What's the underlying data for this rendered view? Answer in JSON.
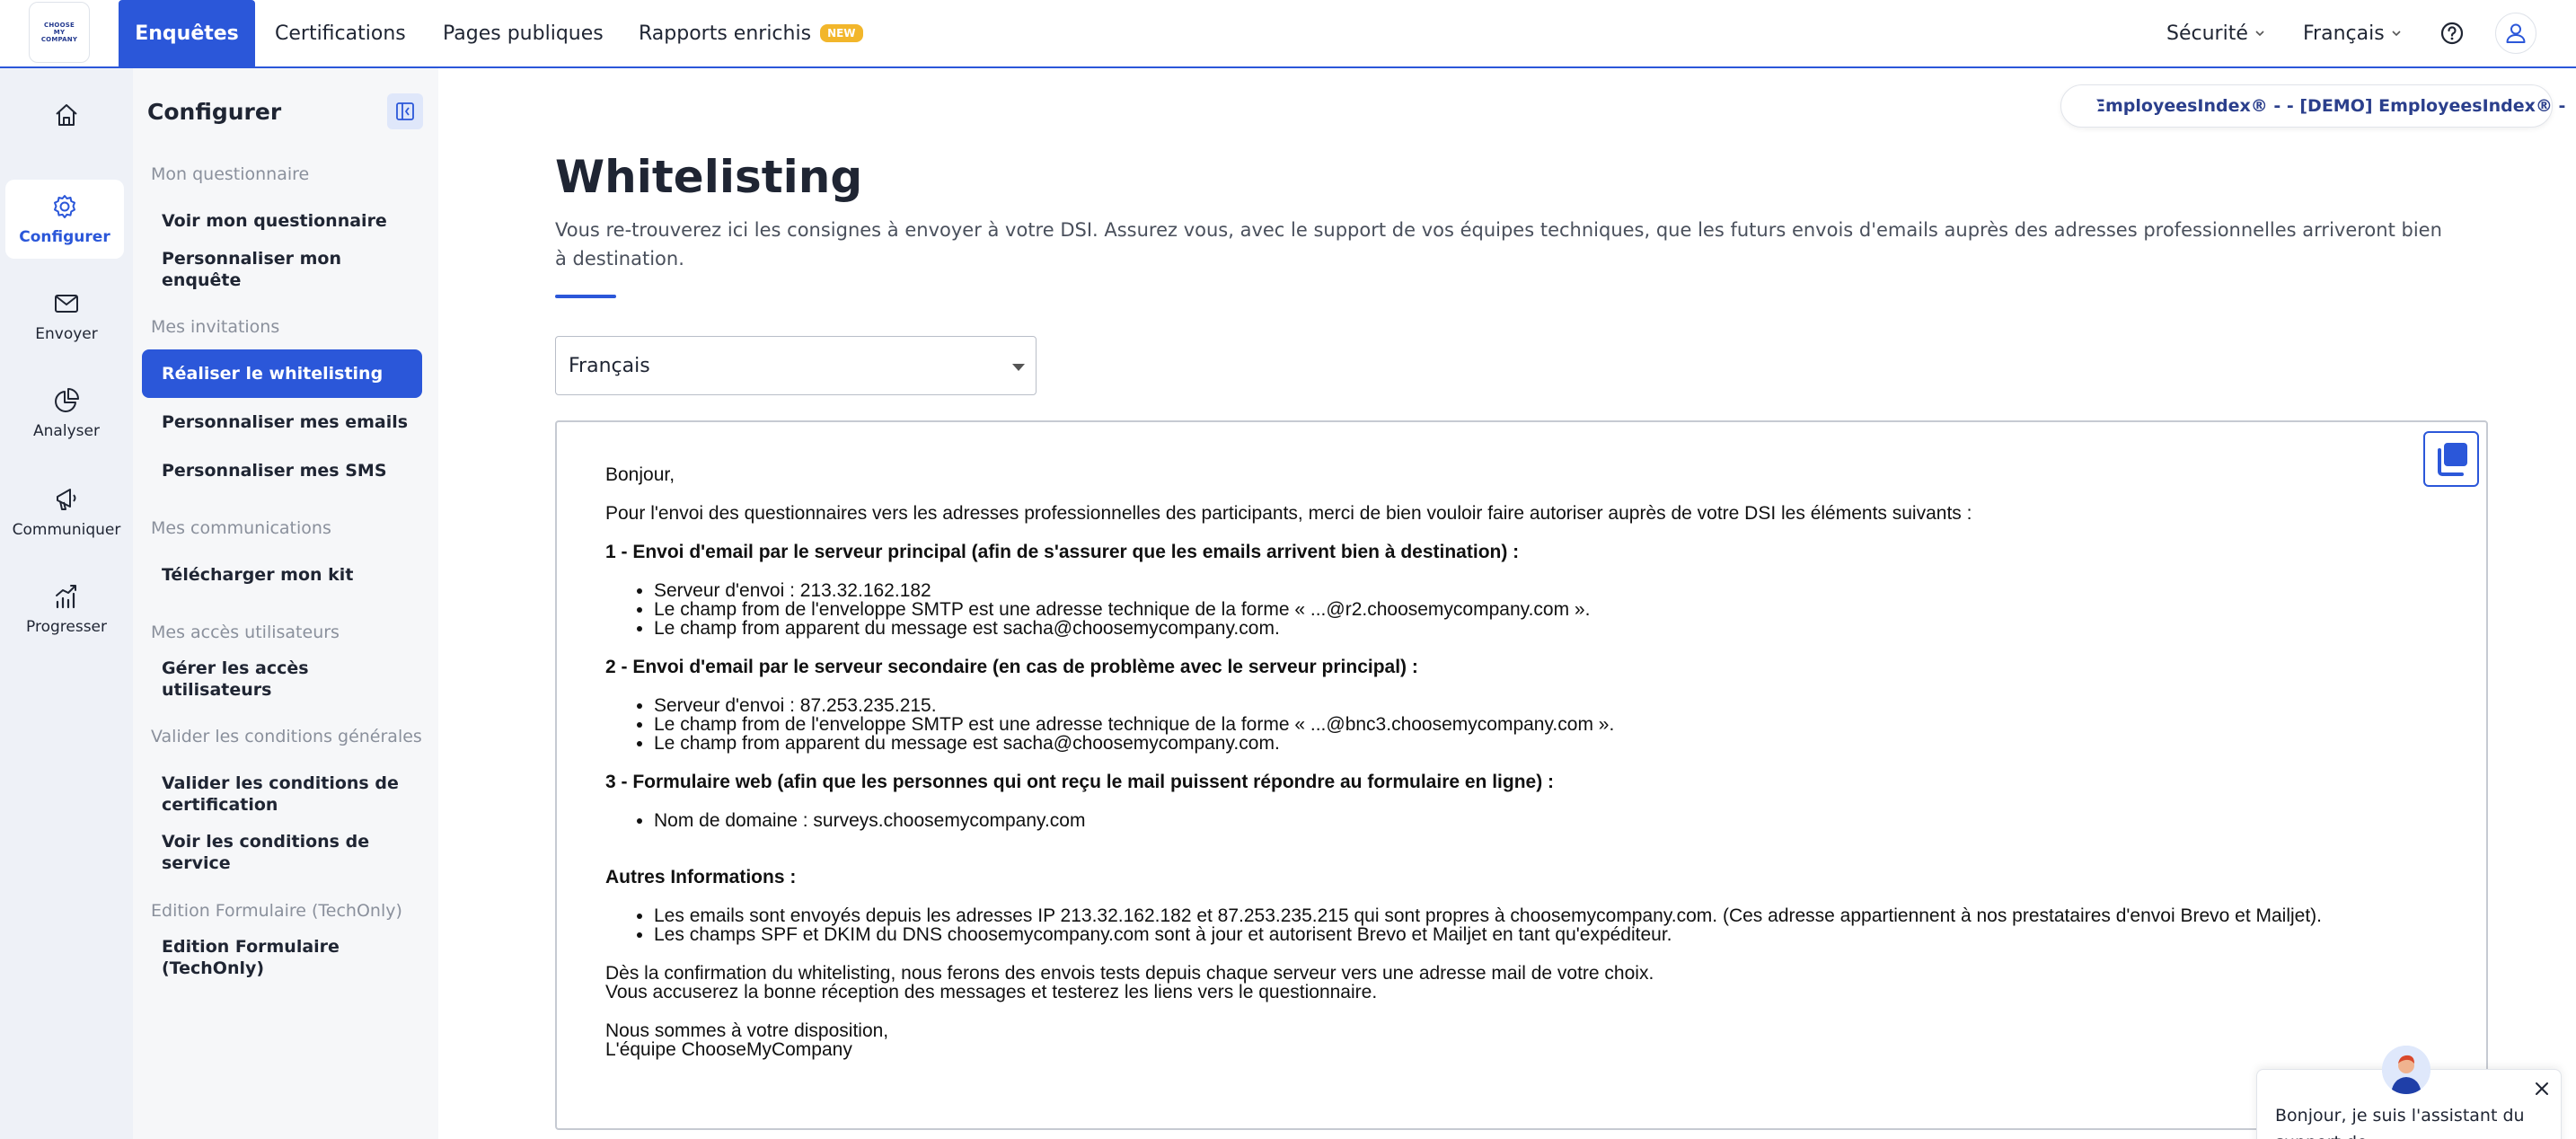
{
  "topbar": {
    "logo_line1": "CHOOSE",
    "logo_line2": "MY",
    "logo_line3": "COMPANY",
    "nav": [
      "Enquêtes",
      "Certifications",
      "Pages publiques",
      "Rapports enrichis"
    ],
    "new_badge": "NEW",
    "security": "Sécurité",
    "language": "Français"
  },
  "rail": {
    "items": [
      "Configurer",
      "Envoyer",
      "Analyser",
      "Communiquer",
      "Progresser"
    ]
  },
  "sidebar": {
    "title": "Configurer",
    "groups": [
      "Mon questionnaire",
      "Mes invitations",
      "Mes communications",
      "Mes accès utilisateurs",
      "Valider les conditions générales",
      "Edition Formulaire (TechOnly)"
    ],
    "links": [
      "Voir mon questionnaire",
      "Personnaliser mon enquête",
      "Réaliser le whitelisting",
      "Personnaliser mes emails",
      "Personnaliser mes SMS",
      "Télécharger mon kit",
      "Gérer les accès utilisateurs",
      "Valider les conditions de certification",
      "Voir les conditions de service",
      "Edition Formulaire (TechOnly)"
    ]
  },
  "main": {
    "context_label": "EmployeesIndex® - - [DEMO] EmployeesIndex® -",
    "title": "Whitelisting",
    "description": "Vous re-trouverez ici les consignes à envoyer à votre DSI. Assurez vous, avec le support de vos équipes techniques, que les futurs envois d'emails auprès des adresses professionnelles arriveront bien à destination.",
    "language_select": "Français"
  },
  "letter": {
    "greeting": "Bonjour,",
    "intro": "Pour l'envoi des questionnaires vers les adresses professionnelles des participants, merci de bien vouloir faire autoriser auprès de votre DSI les éléments suivants :",
    "s1_title": "1 - Envoi d'email par le serveur principal (afin de s'assurer que les emails arrivent bien à destination) :",
    "s1_items": [
      "Serveur d'envoi : 213.32.162.182",
      "Le champ from de l'enveloppe SMTP est une adresse technique de la forme « ...@r2.choosemycompany.com ».",
      "Le champ from apparent du message est sacha@choosemycompany.com."
    ],
    "s2_title": "2 - Envoi d'email par le serveur secondaire (en cas de problème avec le serveur principal) :",
    "s2_items": [
      "Serveur d'envoi : 87.253.235.215.",
      "Le champ from de l'enveloppe SMTP est une adresse technique de la forme « ...@bnc3.choosemycompany.com ».",
      "Le champ from apparent du message est sacha@choosemycompany.com."
    ],
    "s3_title": "3 - Formulaire web (afin que les personnes qui ont reçu le mail puissent répondre au formulaire en ligne) :",
    "s3_items": [
      "Nom de domaine : surveys.choosemycompany.com"
    ],
    "other_title": "Autres Informations :",
    "other_items": [
      "Les emails sont envoyés depuis les adresses IP 213.32.162.182 et 87.253.235.215 qui sont propres à choosemycompany.com. (Ces adresse appartiennent à nos prestataires d'envoi Brevo et Mailjet).",
      "Les champs SPF et DKIM du DNS choosemycompany.com sont à jour et autorisent Brevo et Mailjet en tant qu'expéditeur."
    ],
    "closing_1": "Dès la confirmation du whitelisting, nous ferons des envois tests depuis chaque serveur vers une adresse mail de votre choix.",
    "closing_2": "Vous accuserez la bonne réception des messages et testerez les liens vers le questionnaire.",
    "signoff_1": "Nous sommes à votre disposition,",
    "signoff_2": "L'équipe ChooseMyCompany"
  },
  "chat": {
    "text": "Bonjour, je suis l'assistant du support de ChooseMyCompany !"
  },
  "colors": {
    "accent": "#2b57d9",
    "badge": "#f2b62b",
    "rail_bg": "#eef1f7",
    "sidebar_bg": "#f6f7f9"
  },
  "icons": [
    "home-icon",
    "gear-icon",
    "envelope-icon",
    "pie-chart-icon",
    "megaphone-icon",
    "growth-chart-icon",
    "help-icon",
    "user-icon",
    "collapse-sidebar-icon",
    "copy-icon",
    "close-icon"
  ]
}
